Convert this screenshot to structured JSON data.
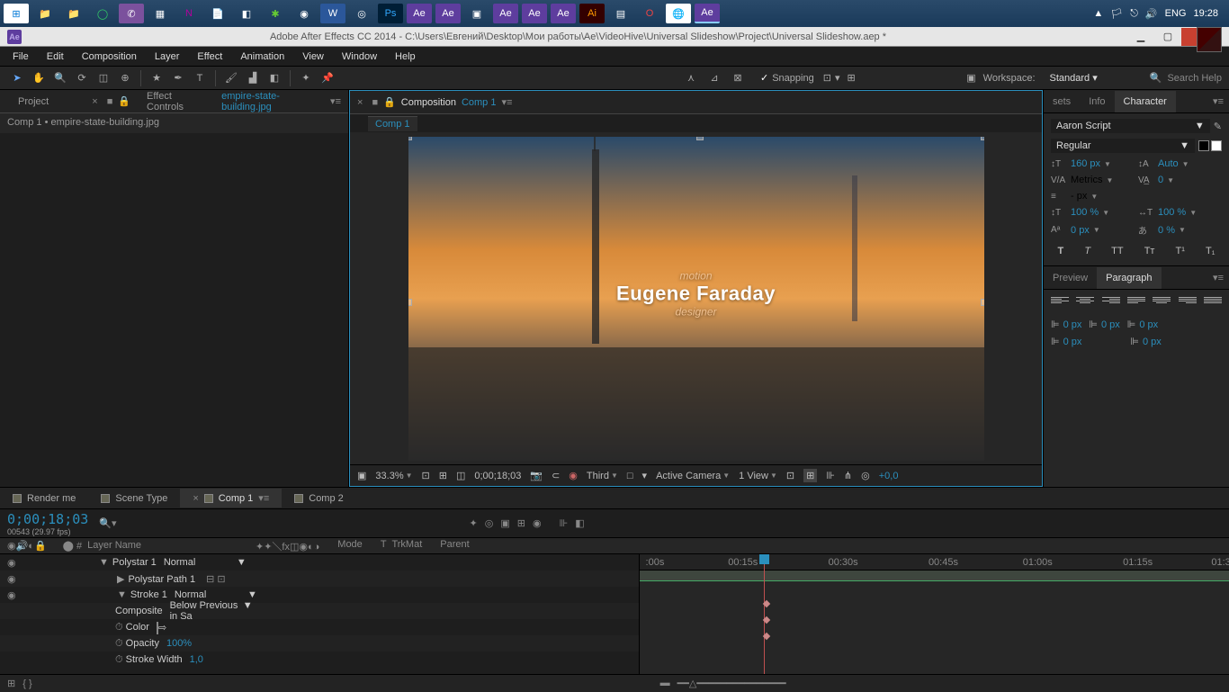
{
  "system": {
    "lang": "ENG",
    "time": "19:28"
  },
  "titlebar": {
    "app_icon": "Ae",
    "title": "Adobe After Effects CC 2014 - C:\\Users\\Евгений\\Desktop\\Мои работы\\Ae\\VideoHive\\Universal Slideshow\\Project\\Universal Slideshow.aep *"
  },
  "menu": {
    "file": "File",
    "edit": "Edit",
    "composition": "Composition",
    "layer": "Layer",
    "effect": "Effect",
    "animation": "Animation",
    "view": "View",
    "window": "Window",
    "help": "Help"
  },
  "toolbar": {
    "snapping": "Snapping",
    "workspace_label": "Workspace:",
    "workspace_value": "Standard",
    "search_placeholder": "Search Help"
  },
  "project_panel": {
    "project_tab": "Project",
    "effect_controls_tab": "Effect Controls",
    "effect_controls_item": "empire-state-building.jpg",
    "breadcrumb": "Comp 1 • empire-state-building.jpg"
  },
  "comp_panel": {
    "composition_tab": "Composition",
    "comp_name": "Comp 1",
    "sub_tab": "Comp 1",
    "overlay": {
      "top": "motion",
      "name": "Eugene Faraday",
      "bottom": "designer"
    },
    "footer": {
      "zoom": "33.3%",
      "timecode": "0;00;18;03",
      "third": "Third",
      "camera": "Active Camera",
      "view": "1 View",
      "exposure": "+0,0"
    }
  },
  "character_panel": {
    "tab_sets": "sets",
    "tab_info": "Info",
    "tab_character": "Character",
    "font": "Aaron Script",
    "style": "Regular",
    "size": "160",
    "size_unit": "px",
    "leading": "Auto",
    "kerning": "Metrics",
    "tracking": "0",
    "line_unit": "px",
    "vscale": "100",
    "pct": "%",
    "hscale": "100",
    "baseline": "0",
    "baseline_unit": "px",
    "tsume": "0",
    "faux": {
      "T": "T",
      "Ti": "T",
      "TT": "TT",
      "Tt": "Tᴛ",
      "Tsup": "T¹",
      "Tsub": "T₁"
    }
  },
  "paragraph_panel": {
    "tab_preview": "Preview",
    "tab_paragraph": "Paragraph",
    "px0": "0 px"
  },
  "timeline": {
    "tab_render": "Render me",
    "tab_scene": "Scene Type",
    "tab_comp1": "Comp 1",
    "tab_comp2": "Comp 2",
    "timecode": "0;00;18;03",
    "frame_info": "00543 (29.97 fps)",
    "col_layer": "Layer Name",
    "col_mode": "Mode",
    "col_trkmat": "TrkMat",
    "col_parent": "Parent",
    "ticks": [
      ":00s",
      "00:15s",
      "00:30s",
      "00:45s",
      "01:00s",
      "01:15s",
      "01:30"
    ],
    "layers": {
      "polystar": "Polystar 1",
      "polystar_path": "Polystar Path 1",
      "stroke": "Stroke 1",
      "composite": "Composite",
      "composite_val": "Below Previous in Sa",
      "color": "Color",
      "opacity": "Opacity",
      "opacity_val": "100%",
      "stroke_width": "Stroke Width",
      "stroke_width_val": "1,0",
      "normal": "Normal"
    }
  }
}
